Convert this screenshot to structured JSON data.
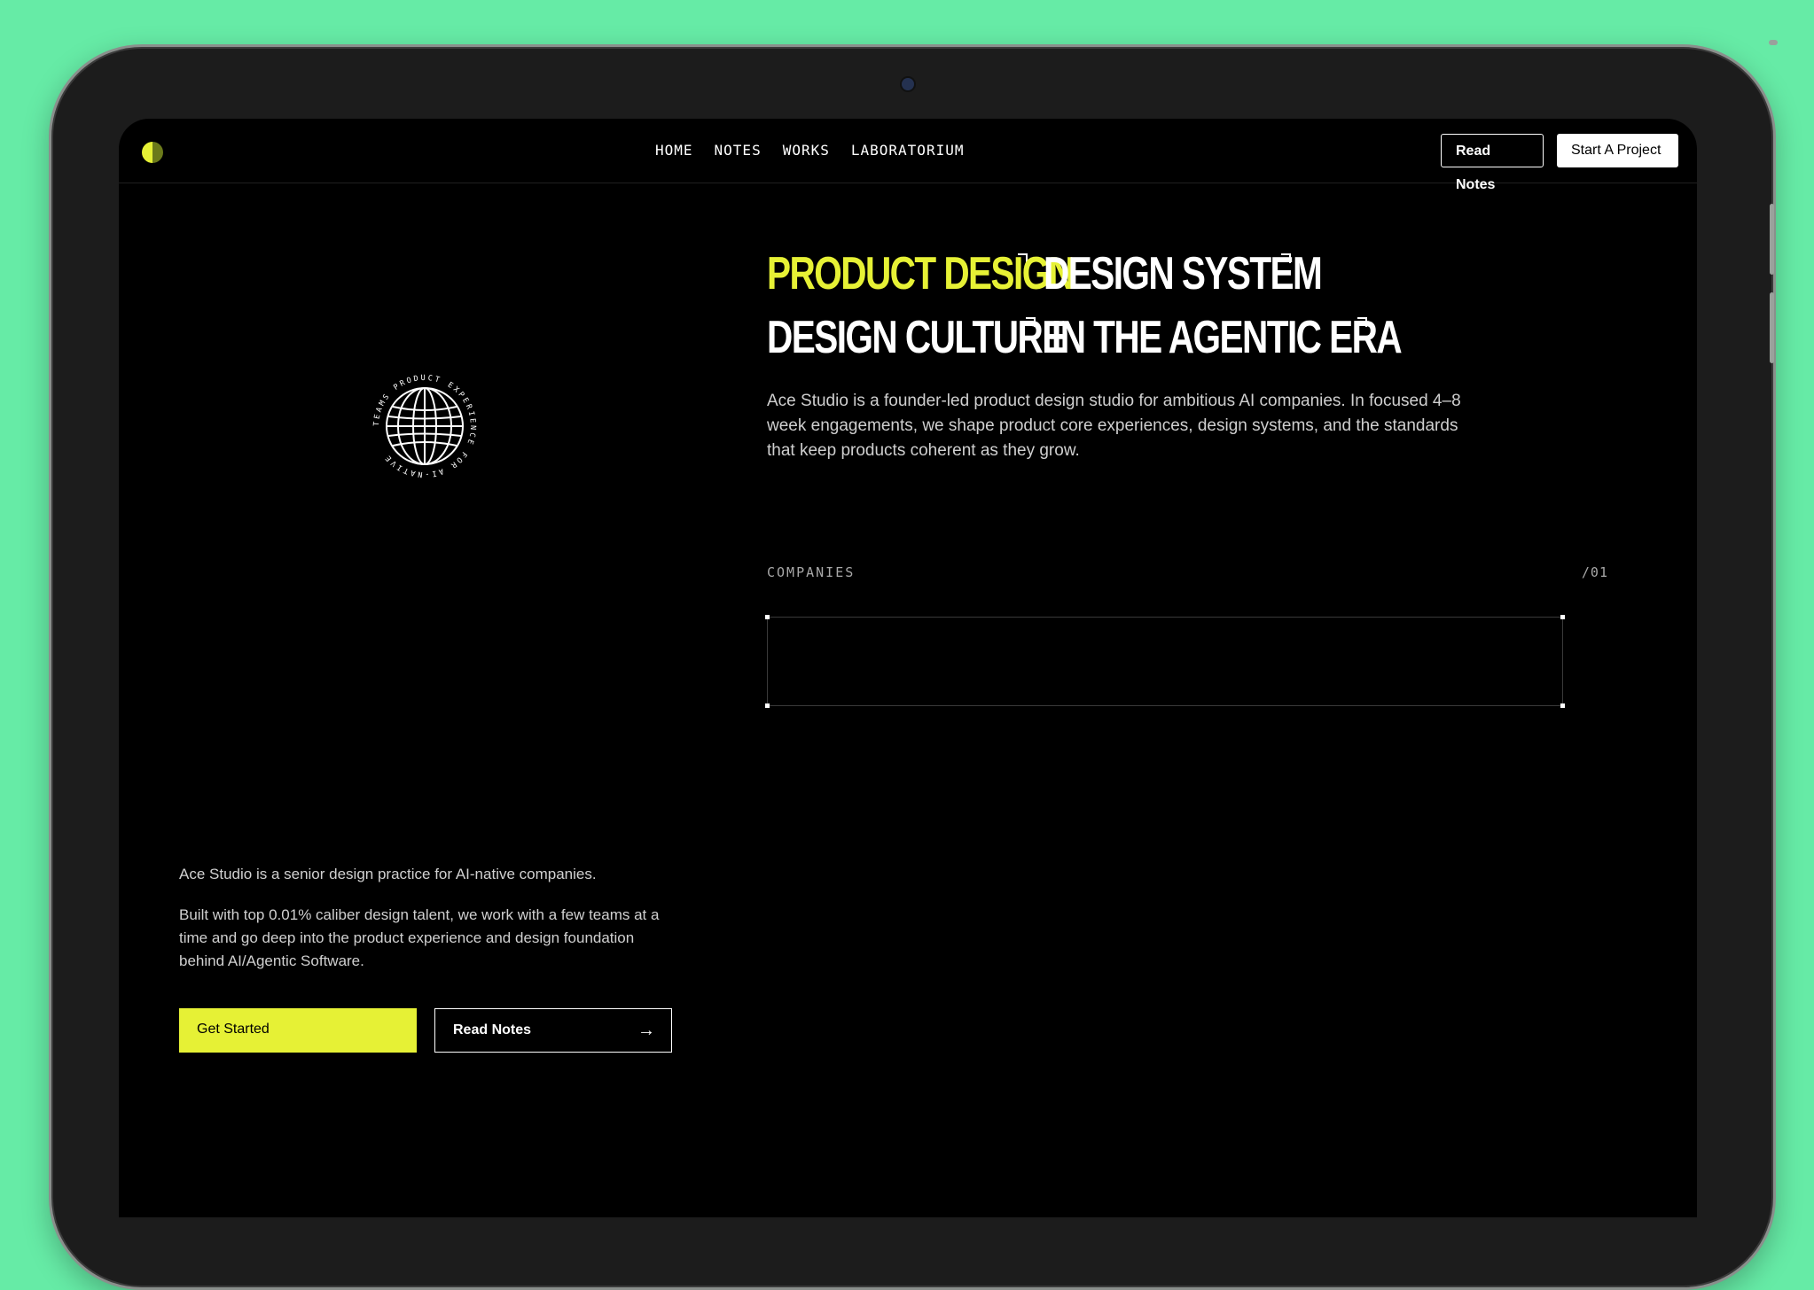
{
  "nav": {
    "items": [
      "HOME",
      "NOTES",
      "WORKS",
      "LABORATORIUM"
    ],
    "read_notes": "Read Notes",
    "start_project": "Start A Project"
  },
  "hero": {
    "line1_a": "PRODUCT DESIGN",
    "line1_b": "DESIGN SYSTEM",
    "line2_a": "DESIGN CULTURE",
    "line2_b": "IN THE AGENTIC ERA",
    "description": "Ace Studio is a founder-led product design studio for ambitious AI companies. In focused 4–8 week engagements, we shape product core experiences, design systems, and the standards that keep products coherent as they grow.",
    "badge_text": "TEAMS PRODUCT EXPERIENCE FOR AI-NATIVE"
  },
  "companies": {
    "label": "COMPANIES",
    "index": "/01"
  },
  "intro": {
    "p1": "Ace Studio is a senior design practice for AI-native companies.",
    "p2": "Built with top 0.01% caliber design talent, we work with a few teams at a time and go deep into the product experience and design foundation behind AI/Agentic Software."
  },
  "cta": {
    "primary": "Get Started",
    "secondary": "Read Notes",
    "secondary_icon": "arrow-right-icon"
  },
  "colors": {
    "accent": "#e6f135",
    "background": "#000000",
    "frame": "#66eba6"
  }
}
